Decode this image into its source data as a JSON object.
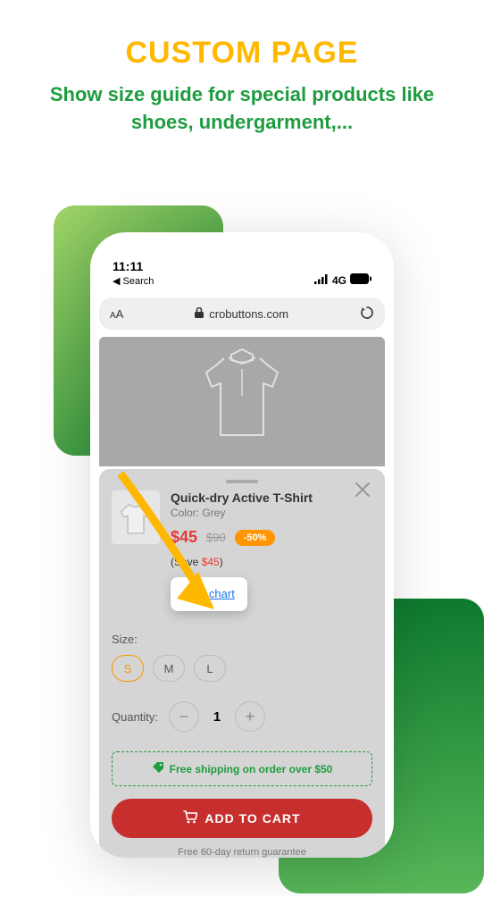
{
  "header": {
    "title": "CUSTOM PAGE",
    "subtitle": "Show size guide for special products like shoes, undergarment,..."
  },
  "status": {
    "time": "11:11",
    "back": "Search",
    "network": "4G"
  },
  "urlbar": {
    "domain": "crobuttons.com"
  },
  "product": {
    "name": "Quick-dry Active T-Shirt",
    "color_label": "Color: Grey",
    "price": "$45",
    "price_old": "$90",
    "discount": "-50%",
    "save_prefix": "(Save ",
    "save_amount": "$45",
    "save_suffix": ")",
    "size_chart": "Size chart"
  },
  "size": {
    "label": "Size:",
    "options": [
      "S",
      "M",
      "L"
    ],
    "selected": "S"
  },
  "quantity": {
    "label": "Quantity:",
    "value": "1"
  },
  "shipping": {
    "text": "Free shipping on order over $50"
  },
  "cart": {
    "label": "ADD TO CART"
  },
  "return": {
    "text": "Free 60-day return guarantee"
  }
}
